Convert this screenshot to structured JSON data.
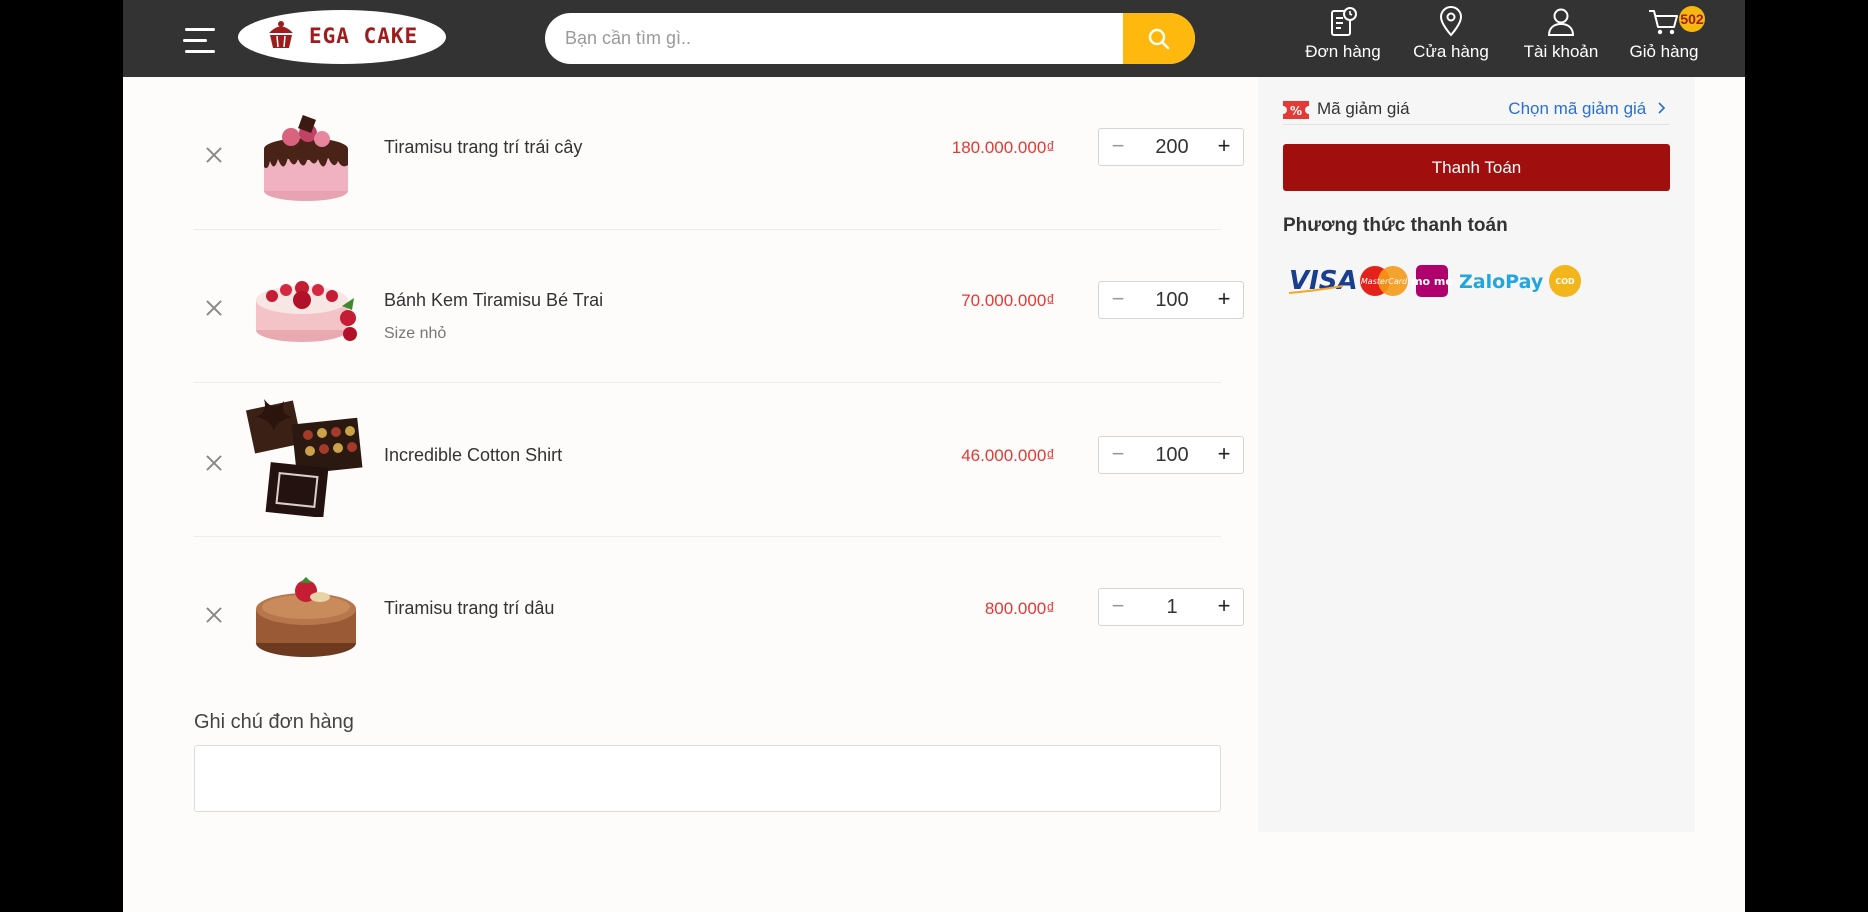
{
  "header": {
    "logo_text": "EGA CAKE",
    "search_placeholder": "Bạn cần tìm gì..",
    "nav": [
      {
        "label": "Đơn hàng",
        "icon": "orders-icon"
      },
      {
        "label": "Cửa hàng",
        "icon": "location-icon"
      },
      {
        "label": "Tài khoản",
        "icon": "user-icon"
      },
      {
        "label": "Giỏ hàng",
        "icon": "cart-icon"
      }
    ],
    "cart_count": "502"
  },
  "cart": {
    "items": [
      {
        "name": "Tiramisu trang trí trái cây",
        "variant": "",
        "price": "180.000.000₫",
        "qty": "200"
      },
      {
        "name": "Bánh Kem Tiramisu Bé Trai",
        "variant": "Size nhỏ",
        "price": "70.000.000₫",
        "qty": "100"
      },
      {
        "name": "Incredible Cotton Shirt",
        "variant": "",
        "price": "46.000.000₫",
        "qty": "100"
      },
      {
        "name": "Tiramisu trang trí dâu",
        "variant": "",
        "price": "800.000₫",
        "qty": "1"
      }
    ],
    "note_label": "Ghi chú đơn hàng"
  },
  "summary": {
    "coupon_label": "Mã giảm giá",
    "coupon_link": "Chọn mã giảm giá",
    "checkout_label": "Thanh Toán",
    "payment_title": "Phương thức thanh toán",
    "payment_methods": [
      "VISA",
      "MasterCard",
      "mo mo",
      "ZaloPay",
      "COD"
    ]
  },
  "colors": {
    "header_bg": "#333333",
    "accent_yellow": "#ffb80d",
    "price_red": "#e53935",
    "checkout_red": "#a10e0e",
    "link_blue": "#2a6fd6"
  }
}
